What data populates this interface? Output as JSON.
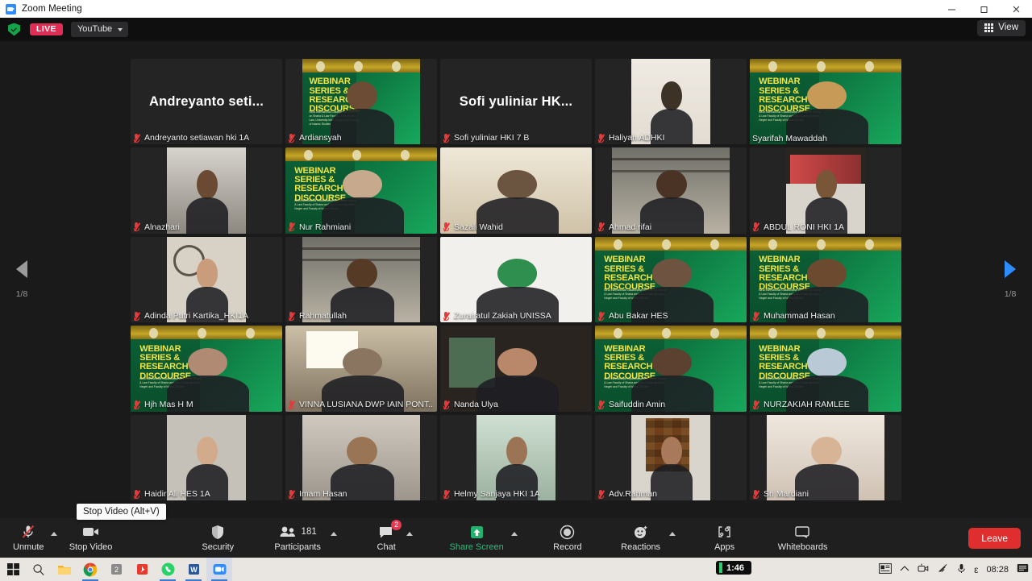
{
  "window": {
    "title": "Zoom Meeting",
    "app_icon": "zoom-icon",
    "minimize": "minimize-icon",
    "maximize": "maximize-icon",
    "close": "close-icon"
  },
  "livebar": {
    "shield_icon": "shield-check-icon",
    "live_label": "LIVE",
    "platform": "YouTube",
    "view_label": "View",
    "view_icon": "grid-icon"
  },
  "gallery": {
    "page_left": "1/8",
    "page_right": "1/8",
    "prev_icon": "chevron-left-icon",
    "next_icon": "chevron-right-icon",
    "webinar_text": "WEBINAR SERIES & RESEARCH DISCOURSE",
    "webinar_sub": "Ba'ai International Collaborative Webinar on Sharia & Law Faculty of Sharia and Law, University Islam Negeri and Faculty of Islamic Studies",
    "tiles": [
      {
        "name": "Andreyanto setiawan hki 1A",
        "display_name": "Andreyanto  seti...",
        "video": false,
        "muted": true,
        "active": false,
        "bg": "none"
      },
      {
        "name": "Ardiansyah",
        "video": true,
        "muted": true,
        "active": false,
        "bg": "webinar",
        "skin": "#6d4c35",
        "w": 78
      },
      {
        "name": "Sofi yuliniar HKI 7 B",
        "display_name": "Sofi yuliniar HK...",
        "video": false,
        "muted": true,
        "active": false,
        "bg": "none"
      },
      {
        "name": "Haliyah ADHKI",
        "video": true,
        "muted": true,
        "active": false,
        "bg": "room-light",
        "skin": "#3c3226",
        "w": 52
      },
      {
        "name": "Syarifah Mawaddah",
        "video": true,
        "muted": false,
        "active": true,
        "bg": "webinar",
        "skin": "#c79a58",
        "w": 100
      },
      {
        "name": "Alnazhari",
        "video": true,
        "muted": true,
        "active": false,
        "bg": "room-grey",
        "skin": "#6a4a33",
        "w": 52
      },
      {
        "name": "Nur Rahmiani",
        "video": true,
        "muted": true,
        "active": false,
        "bg": "webinar",
        "skin": "#c7a98d",
        "w": 100
      },
      {
        "name": "Sazali Wahid",
        "video": true,
        "muted": true,
        "active": false,
        "bg": "room-warm",
        "skin": "#6b5440",
        "w": 100
      },
      {
        "name": "Ahmad rifai",
        "video": true,
        "muted": true,
        "active": false,
        "bg": "hall",
        "skin": "#4a3325",
        "w": 78
      },
      {
        "name": "ABDUL RONI HKI 1A",
        "video": true,
        "muted": true,
        "active": false,
        "bg": "room-red",
        "skin": "#7a5638",
        "w": 52
      },
      {
        "name": "Adinda Putri Kartika_HKI1A",
        "video": true,
        "muted": true,
        "active": false,
        "bg": "cafe",
        "skin": "#c99c7c",
        "w": 52
      },
      {
        "name": "Rahmatullah",
        "video": true,
        "muted": true,
        "active": false,
        "bg": "hall",
        "skin": "#553a26",
        "w": 78
      },
      {
        "name": "Zurairatul Zakiah UNISSA",
        "video": true,
        "muted": true,
        "active": false,
        "bg": "room-white",
        "skin": "#2f8f4f",
        "w": 100
      },
      {
        "name": "Abu Bakar HES",
        "video": true,
        "muted": true,
        "active": false,
        "bg": "webinar",
        "skin": "#6d5340",
        "w": 100
      },
      {
        "name": "Muhammad Hasan",
        "video": true,
        "muted": true,
        "active": false,
        "bg": "webinar",
        "skin": "#6b4a30",
        "w": 100
      },
      {
        "name": "Hjh Mas H M",
        "video": true,
        "muted": true,
        "active": false,
        "bg": "webinar",
        "skin": "#b08a72",
        "w": 100
      },
      {
        "name": "VINNA LUSIANA  DWP IAIN PONT...",
        "video": true,
        "muted": true,
        "active": false,
        "bg": "classroom",
        "skin": "#8a7560",
        "w": 100
      },
      {
        "name": "Nanda Ulya",
        "video": true,
        "muted": true,
        "active": false,
        "bg": "room-dark",
        "skin": "#b9886a",
        "w": 100
      },
      {
        "name": "Saifuddin Amin",
        "video": true,
        "muted": true,
        "active": false,
        "bg": "webinar",
        "skin": "#5d4130",
        "w": 100
      },
      {
        "name": "NURZAKIAH RAMLEE",
        "video": true,
        "muted": true,
        "active": false,
        "bg": "webinar",
        "skin": "#b9c9d6",
        "w": 100
      },
      {
        "name": "Haidir Ali HES 1A",
        "video": true,
        "muted": true,
        "active": false,
        "bg": "room-plain",
        "skin": "#d2ab8d",
        "w": 52
      },
      {
        "name": "Imam Hasan",
        "video": true,
        "muted": true,
        "active": false,
        "bg": "room-grey2",
        "skin": "#9a7555",
        "w": 78
      },
      {
        "name": "Helmy Sanjaya HKI 1A",
        "video": true,
        "muted": true,
        "active": false,
        "bg": "outdoor",
        "skin": "#9b7455",
        "w": 52
      },
      {
        "name": "Adv.Rahman",
        "video": true,
        "muted": true,
        "active": false,
        "bg": "brickwall",
        "skin": "#a8795a",
        "w": 52
      },
      {
        "name": "Sri Mardiani",
        "video": true,
        "muted": true,
        "active": false,
        "bg": "group-photo",
        "skin": "#d8b497",
        "w": 78
      }
    ]
  },
  "toolbar": {
    "unmute_label": "Unmute",
    "unmute_icon": "mic-muted-icon",
    "stop_video_label": "Stop Video",
    "stop_video_icon": "camera-icon",
    "video_tooltip": "Stop Video (Alt+V)",
    "security_label": "Security",
    "security_icon": "shield-icon",
    "participants_label": "Participants",
    "participants_icon": "people-icon",
    "participants_count": "181",
    "chat_label": "Chat",
    "chat_icon": "chat-bubble-icon",
    "chat_badge": "2",
    "share_label": "Share Screen",
    "share_icon": "share-up-arrow-icon",
    "record_label": "Record",
    "record_icon": "record-circle-icon",
    "reactions_label": "Reactions",
    "reactions_icon": "smiley-plus-icon",
    "apps_label": "Apps",
    "apps_icon": "apps-bracket-icon",
    "whiteboards_label": "Whiteboards",
    "whiteboards_icon": "whiteboard-icon",
    "leave_label": "Leave"
  },
  "taskbar": {
    "start_icon": "windows-start-icon",
    "search_icon": "search-icon",
    "explorer_icon": "file-explorer-icon",
    "chrome_icon": "chrome-icon",
    "app5_icon": "app-icon",
    "adobe_icon": "adobe-reader-icon",
    "whatsapp_icon": "whatsapp-icon",
    "word_icon": "word-icon",
    "zoom_icon": "zoom-icon",
    "timer": "1:46",
    "tray_news_icon": "news-icon",
    "tray_chevron_icon": "chevron-up-icon",
    "tray_camera_icon": "camera-tray-icon",
    "tray_wifi_icon": "wifi-icon",
    "tray_mic_icon": "mic-icon",
    "tray_ime_icon": "ime-icon",
    "clock": "08:28",
    "notifications_icon": "notification-icon"
  }
}
